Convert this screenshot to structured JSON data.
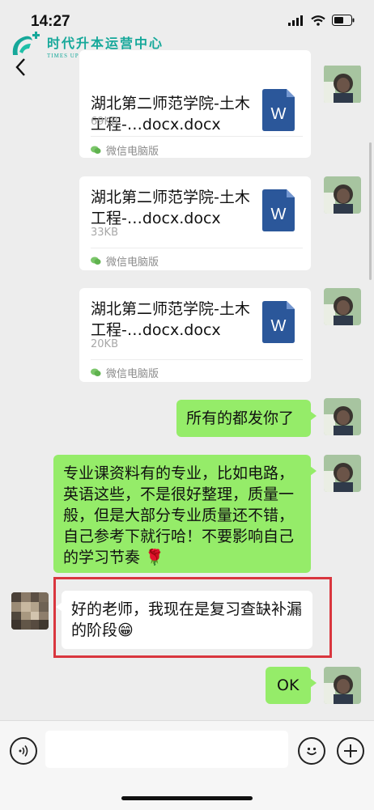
{
  "status_bar": {
    "time": "14:27"
  },
  "watermark": {
    "title_cn": "时代升本运营中心",
    "title_en": "TIMES UPGRADE OPERATION CENTER"
  },
  "messages": [
    {
      "type": "file",
      "side": "right",
      "file_name": "湖北第二师范学院-土木工程-…docx.docx",
      "size": "69KB",
      "source": "微信电脑版"
    },
    {
      "type": "file",
      "side": "right",
      "file_name": "湖北第二师范学院-土木工程-…docx.docx",
      "size": "33KB",
      "source": "微信电脑版"
    },
    {
      "type": "file",
      "side": "right",
      "file_name": "湖北第二师范学院-土木工程-…docx.docx",
      "size": "20KB",
      "source": "微信电脑版"
    },
    {
      "type": "text",
      "side": "right",
      "text": "所有的都发你了"
    },
    {
      "type": "text",
      "side": "right",
      "text": "专业课资料有的专业，比如电路，英语这些，不是很好整理，质量一般，但是大部分专业质量还不错，自己参考下就行哈！不要影响自己的学习节奏 🌹"
    },
    {
      "type": "text",
      "side": "left",
      "text": "好的老师，我现在是复习查缺补漏的阶段😁"
    },
    {
      "type": "text",
      "side": "right",
      "text": "OK"
    }
  ]
}
